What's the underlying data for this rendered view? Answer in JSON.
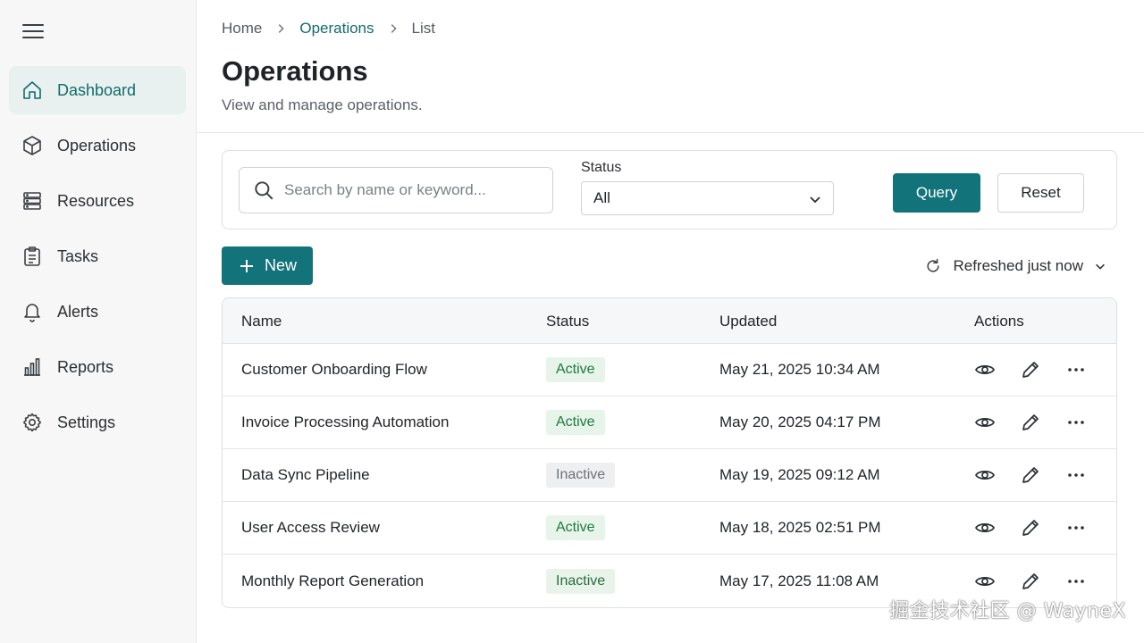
{
  "sidebar": {
    "items": [
      {
        "label": "Dashboard",
        "icon": "home-icon",
        "active": true
      },
      {
        "label": "Operations",
        "icon": "cube-icon"
      },
      {
        "label": "Resources",
        "icon": "server-icon"
      },
      {
        "label": "Tasks",
        "icon": "clipboard-icon"
      },
      {
        "label": "Alerts",
        "icon": "bell-icon"
      },
      {
        "label": "Reports",
        "icon": "bar-chart-icon"
      },
      {
        "label": "Settings",
        "icon": "gear-icon"
      }
    ]
  },
  "breadcrumb": {
    "home": "Home",
    "section": "Operations",
    "current": "List"
  },
  "header": {
    "title": "Operations",
    "subtitle": "View and manage operations."
  },
  "filters": {
    "search_placeholder": "Search by name or keyword...",
    "search_value": "",
    "status_label": "Status",
    "status_value": "All",
    "query_label": "Query",
    "reset_label": "Reset"
  },
  "toolbar": {
    "new_label": "New",
    "refresh_text": "Refreshed just now"
  },
  "table": {
    "columns": {
      "name": "Name",
      "status": "Status",
      "updated": "Updated",
      "actions": "Actions"
    },
    "rows": [
      {
        "name": "Customer Onboarding Flow",
        "status": "Active",
        "updated": "May 21, 2025 10:34 AM"
      },
      {
        "name": "Invoice Processing Automation",
        "status": "Active",
        "updated": "May 20, 2025 04:17 PM"
      },
      {
        "name": "Data Sync Pipeline",
        "status": "Inactive",
        "updated": "May 19, 2025 09:12 AM"
      },
      {
        "name": "User Access Review",
        "status": "Active",
        "updated": "May 18, 2025 02:51 PM"
      },
      {
        "name": "Monthly Report Generation",
        "status": "Inactive",
        "updated": "May 17, 2025 11:08 AM"
      }
    ]
  },
  "watermark": "掘金技术社区 @ WayneX",
  "colors": {
    "accent": "#12737a",
    "active_nav_bg": "#e8f1ef",
    "active_badge_bg": "#e6f4ea",
    "inactive_badge_bg": "#eeeff0"
  }
}
